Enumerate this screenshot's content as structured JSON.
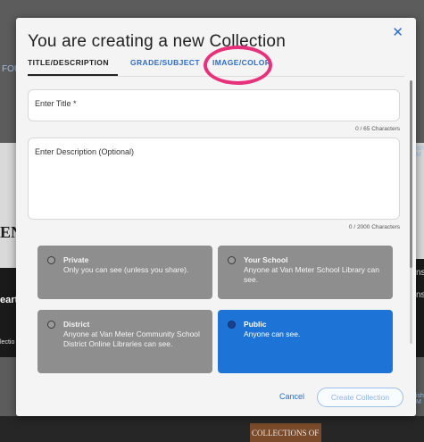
{
  "background": {
    "left_fragments": [
      "FOU",
      "ENT",
      "eart",
      "lectio"
    ],
    "right_fragments": [
      "ish M",
      "ns",
      "ns",
      "ish M"
    ],
    "bottom_fragment": "COLLECTIONS OF"
  },
  "modal": {
    "title": "You are creating a new Collection",
    "close_label": "✕",
    "tabs": [
      {
        "label": "TITLE/DESCRIPTION"
      },
      {
        "label": "GRADE/SUBJECT"
      },
      {
        "label": "IMAGE/COLOR"
      }
    ],
    "title_input": {
      "placeholder": "Enter Title *",
      "counter": "0 / 65 Characters"
    },
    "description_input": {
      "placeholder": "Enter Description (Optional)",
      "counter": "0 / 2000 Characters"
    },
    "visibility_options": [
      {
        "title": "Private",
        "description": "Only you can see (unless you share).",
        "selected": false
      },
      {
        "title": "Your School",
        "description": "Anyone at Van Meter School Library can see.",
        "selected": false
      },
      {
        "title": "District",
        "description": "Anyone at Van Meter Community School District Online Libraries can see.",
        "selected": false
      },
      {
        "title": "Public",
        "description": "Anyone can see.",
        "selected": true
      }
    ],
    "cancel_label": "Cancel",
    "create_label": "Create Collection"
  },
  "colors": {
    "accent": "#2d6cc9",
    "selected_card": "#1e74d6",
    "unselected_card": "#8e8e8e",
    "highlight_ring": "#e8317c"
  }
}
